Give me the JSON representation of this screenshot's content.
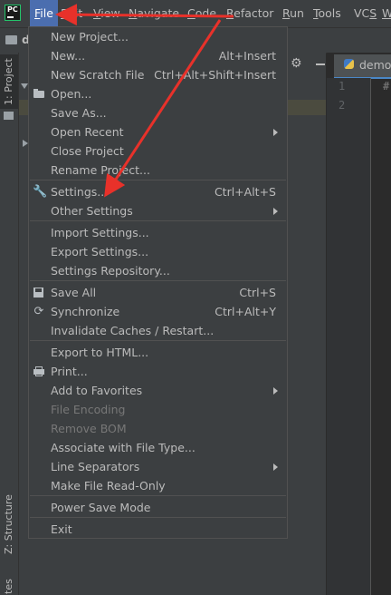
{
  "menubar": {
    "items": [
      {
        "label": "File",
        "u": "F",
        "rest": "ile"
      },
      {
        "label": "Edit",
        "u": "E",
        "rest": "dit"
      },
      {
        "label": "View",
        "u": "V",
        "rest": "iew"
      },
      {
        "label": "Navigate",
        "u": "N",
        "rest": "avigate"
      },
      {
        "label": "Code",
        "u": "C",
        "rest": "ode"
      },
      {
        "label": "Refactor",
        "u": "R",
        "rest": "efactor"
      },
      {
        "label": "Run",
        "u": "R",
        "rest": "un"
      },
      {
        "label": "Tools",
        "u": "T",
        "rest": "ools"
      },
      {
        "label": "VCS",
        "u": "S",
        "rest": "VC"
      },
      {
        "label": "W",
        "u": "W",
        "rest": ""
      }
    ],
    "active_color": "#4b6eaf"
  },
  "logo": {
    "text": "PC"
  },
  "nav": {
    "project_label": "d"
  },
  "toolstrip": {
    "project_tab": "1: Project",
    "structure_tab": "Z: Structure",
    "favorites_tab": "tes"
  },
  "editor": {
    "tab_label": "demo",
    "line_numbers": [
      "1",
      "2"
    ],
    "code_line1": "#"
  },
  "file_menu": {
    "items": [
      {
        "label": "New Project...",
        "shortcut": "",
        "submenu": false,
        "disabled": false,
        "icon": ""
      },
      {
        "label": "New...",
        "shortcut": "Alt+Insert",
        "submenu": false,
        "disabled": false,
        "icon": ""
      },
      {
        "label": "New Scratch File",
        "shortcut": "Ctrl+Alt+Shift+Insert",
        "submenu": false,
        "disabled": false,
        "icon": ""
      },
      {
        "label": "Open...",
        "shortcut": "",
        "submenu": false,
        "disabled": false,
        "icon": "folder-open-icon"
      },
      {
        "label": "Save As...",
        "shortcut": "",
        "submenu": false,
        "disabled": false,
        "icon": ""
      },
      {
        "label": "Open Recent",
        "shortcut": "",
        "submenu": true,
        "disabled": false,
        "icon": ""
      },
      {
        "label": "Close Project",
        "shortcut": "",
        "submenu": false,
        "disabled": false,
        "icon": ""
      },
      {
        "label": "Rename Project...",
        "shortcut": "",
        "submenu": false,
        "disabled": false,
        "icon": ""
      },
      {
        "label": "Settings...",
        "shortcut": "Ctrl+Alt+S",
        "submenu": false,
        "disabled": false,
        "icon": "wrench-icon"
      },
      {
        "label": "Other Settings",
        "shortcut": "",
        "submenu": true,
        "disabled": false,
        "icon": ""
      },
      {
        "label": "Import Settings...",
        "shortcut": "",
        "submenu": false,
        "disabled": false,
        "icon": ""
      },
      {
        "label": "Export Settings...",
        "shortcut": "",
        "submenu": false,
        "disabled": false,
        "icon": ""
      },
      {
        "label": "Settings Repository...",
        "shortcut": "",
        "submenu": false,
        "disabled": false,
        "icon": ""
      },
      {
        "label": "Save All",
        "shortcut": "Ctrl+S",
        "submenu": false,
        "disabled": false,
        "icon": "save-icon"
      },
      {
        "label": "Synchronize",
        "shortcut": "Ctrl+Alt+Y",
        "submenu": false,
        "disabled": false,
        "icon": "sync-icon"
      },
      {
        "label": "Invalidate Caches / Restart...",
        "shortcut": "",
        "submenu": false,
        "disabled": false,
        "icon": ""
      },
      {
        "label": "Export to HTML...",
        "shortcut": "",
        "submenu": false,
        "disabled": false,
        "icon": ""
      },
      {
        "label": "Print...",
        "shortcut": "",
        "submenu": false,
        "disabled": false,
        "icon": "print-icon"
      },
      {
        "label": "Add to Favorites",
        "shortcut": "",
        "submenu": true,
        "disabled": false,
        "icon": ""
      },
      {
        "label": "File Encoding",
        "shortcut": "",
        "submenu": false,
        "disabled": true,
        "icon": ""
      },
      {
        "label": "Remove BOM",
        "shortcut": "",
        "submenu": false,
        "disabled": true,
        "icon": ""
      },
      {
        "label": "Associate with File Type...",
        "shortcut": "",
        "submenu": false,
        "disabled": false,
        "icon": ""
      },
      {
        "label": "Line Separators",
        "shortcut": "",
        "submenu": true,
        "disabled": false,
        "icon": ""
      },
      {
        "label": "Make File Read-Only",
        "shortcut": "",
        "submenu": false,
        "disabled": false,
        "icon": ""
      },
      {
        "label": "Power Save Mode",
        "shortcut": "",
        "submenu": false,
        "disabled": false,
        "icon": ""
      },
      {
        "label": "Exit",
        "shortcut": "",
        "submenu": false,
        "disabled": false,
        "icon": ""
      }
    ]
  },
  "annotation": {
    "arrow_color": "#e8312a"
  }
}
